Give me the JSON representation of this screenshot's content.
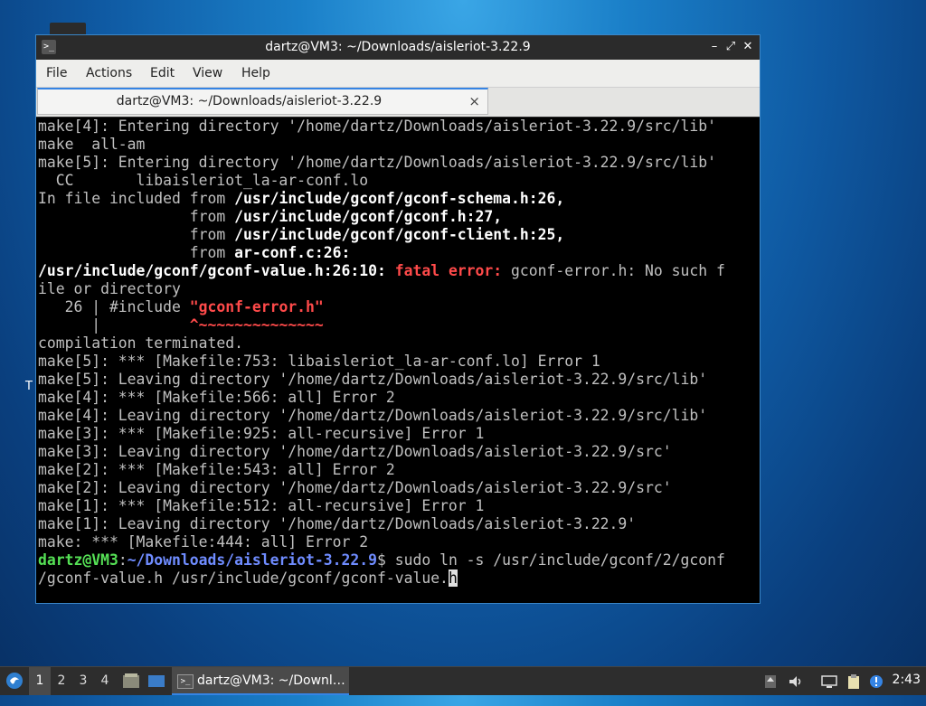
{
  "window": {
    "title": "dartz@VM3: ~/Downloads/aisleriot-3.22.9",
    "controls": {
      "minimize": "–",
      "maximize": "⤢",
      "close": "✕"
    }
  },
  "menu": [
    "File",
    "Actions",
    "Edit",
    "View",
    "Help"
  ],
  "tab": {
    "label": "dartz@VM3: ~/Downloads/aisleriot-3.22.9",
    "close": "×"
  },
  "terminal": {
    "lines": [
      [
        {
          "t": "make[4]: Entering directory '/home/dartz/Downloads/aisleriot-3.22.9/src/lib'"
        }
      ],
      [
        {
          "t": "make  all-am"
        }
      ],
      [
        {
          "t": "make[5]: Entering directory '/home/dartz/Downloads/aisleriot-3.22.9/src/lib'"
        }
      ],
      [
        {
          "t": "  CC       libaisleriot_la-ar-conf.lo"
        }
      ],
      [
        {
          "t": "In file included from "
        },
        {
          "t": "/usr/include/gconf/gconf-schema.h:26",
          "c": "b"
        },
        {
          "t": ",",
          "c": "b"
        }
      ],
      [
        {
          "t": "                 from "
        },
        {
          "t": "/usr/include/gconf/gconf.h:27",
          "c": "b"
        },
        {
          "t": ",",
          "c": "b"
        }
      ],
      [
        {
          "t": "                 from "
        },
        {
          "t": "/usr/include/gconf/gconf-client.h:25",
          "c": "b"
        },
        {
          "t": ",",
          "c": "b"
        }
      ],
      [
        {
          "t": "                 from "
        },
        {
          "t": "ar-conf.c:26",
          "c": "b"
        },
        {
          "t": ":",
          "c": "b"
        }
      ],
      [
        {
          "t": "/usr/include/gconf/gconf-value.h:26:10: ",
          "c": "b"
        },
        {
          "t": "fatal error: ",
          "c": "red"
        },
        {
          "t": "gconf-error.h: No such f"
        }
      ],
      [
        {
          "t": "ile or directory"
        }
      ],
      [
        {
          "t": "   26 | #include "
        },
        {
          "t": "\"gconf-error.h\"",
          "c": "red"
        }
      ],
      [
        {
          "t": "      |          "
        },
        {
          "t": "^~~~~~~~~~~~~~~",
          "c": "red"
        }
      ],
      [
        {
          "t": "compilation terminated."
        }
      ],
      [
        {
          "t": "make[5]: *** [Makefile:753: libaisleriot_la-ar-conf.lo] Error 1"
        }
      ],
      [
        {
          "t": "make[5]: Leaving directory '/home/dartz/Downloads/aisleriot-3.22.9/src/lib'"
        }
      ],
      [
        {
          "t": "make[4]: *** [Makefile:566: all] Error 2"
        }
      ],
      [
        {
          "t": "make[4]: Leaving directory '/home/dartz/Downloads/aisleriot-3.22.9/src/lib'"
        }
      ],
      [
        {
          "t": "make[3]: *** [Makefile:925: all-recursive] Error 1"
        }
      ],
      [
        {
          "t": "make[3]: Leaving directory '/home/dartz/Downloads/aisleriot-3.22.9/src'"
        }
      ],
      [
        {
          "t": "make[2]: *** [Makefile:543: all] Error 2"
        }
      ],
      [
        {
          "t": "make[2]: Leaving directory '/home/dartz/Downloads/aisleriot-3.22.9/src'"
        }
      ],
      [
        {
          "t": "make[1]: *** [Makefile:512: all-recursive] Error 1"
        }
      ],
      [
        {
          "t": "make[1]: Leaving directory '/home/dartz/Downloads/aisleriot-3.22.9'"
        }
      ],
      [
        {
          "t": "make: *** [Makefile:444: all] Error 2"
        }
      ],
      [
        {
          "t": "dartz@VM3",
          "c": "green"
        },
        {
          "t": ":"
        },
        {
          "t": "~/Downloads/aisleriot-3.22.9",
          "c": "blue"
        },
        {
          "t": "$ sudo ln -s /usr/include/gconf/2/gconf"
        }
      ],
      [
        {
          "t": "/gconf-value.h /usr/include/gconf/gconf-value."
        },
        {
          "t": "h",
          "c": "cursor"
        }
      ]
    ]
  },
  "desktop": {
    "fragment": "T"
  },
  "taskbar": {
    "workspaces": [
      "1",
      "2",
      "3",
      "4"
    ],
    "active_workspace": "1",
    "task_label": "dartz@VM3: ~/Downl…",
    "clock": "2:43"
  }
}
